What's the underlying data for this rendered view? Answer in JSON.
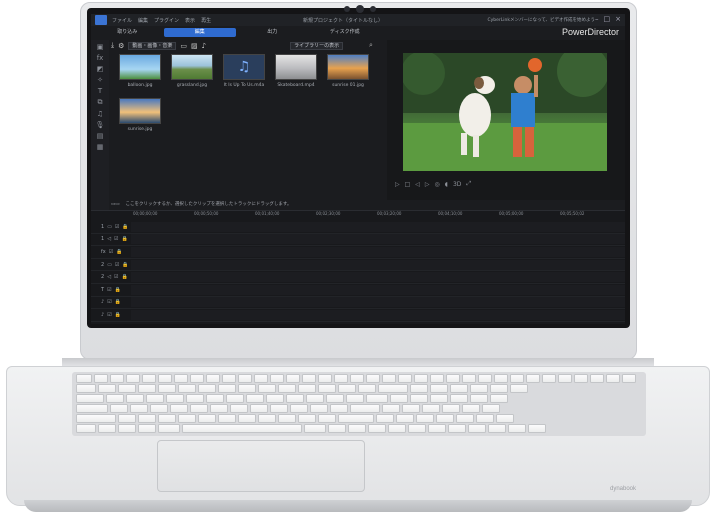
{
  "app": {
    "brand": "PowerDirector",
    "menu": [
      "ファイル",
      "編集",
      "プラグイン",
      "表示",
      "再生"
    ],
    "project_title": "新規プロジェクト（タイトルなし）",
    "notice": "CyberLinkメンバーになって、ビデオ作成を始めよう"
  },
  "tabs": [
    {
      "label": "取り込み",
      "active": false
    },
    {
      "label": "編集",
      "active": true
    },
    {
      "label": "出力",
      "active": false
    },
    {
      "label": "ディスク作成",
      "active": false
    }
  ],
  "toolbar": {
    "media_filter": "動画・画像・音楽",
    "library_dropdown": "ライブラリーの表示"
  },
  "media_items": [
    {
      "name": "balloon.jpg",
      "icon": "image-thumbnail"
    },
    {
      "name": "grassland.jpg",
      "icon": "image-thumbnail"
    },
    {
      "name": "It Is Up To Us.m4a",
      "icon": "music-note-icon"
    },
    {
      "name": "Skateboard.mp4",
      "icon": "video-thumbnail"
    },
    {
      "name": "sunrise 01.jpg",
      "icon": "image-thumbnail"
    },
    {
      "name": "sunrise.jpg",
      "icon": "image-thumbnail"
    }
  ],
  "hint": "ここをクリックするか、選択したクリップを選択したトラックにドラッグします。",
  "timeline": {
    "ruler": [
      "00;00;00;00",
      "00;00;50;00",
      "00;01;40;00",
      "00;02;30;00",
      "00;03;20;00",
      "00;04;10;00",
      "00;05;00;00",
      "00;05;50;02"
    ],
    "tracks": [
      "1",
      "1",
      "fx",
      "2",
      "2",
      "T",
      "♪",
      "♪"
    ]
  },
  "laptop_logo": "dynabook"
}
